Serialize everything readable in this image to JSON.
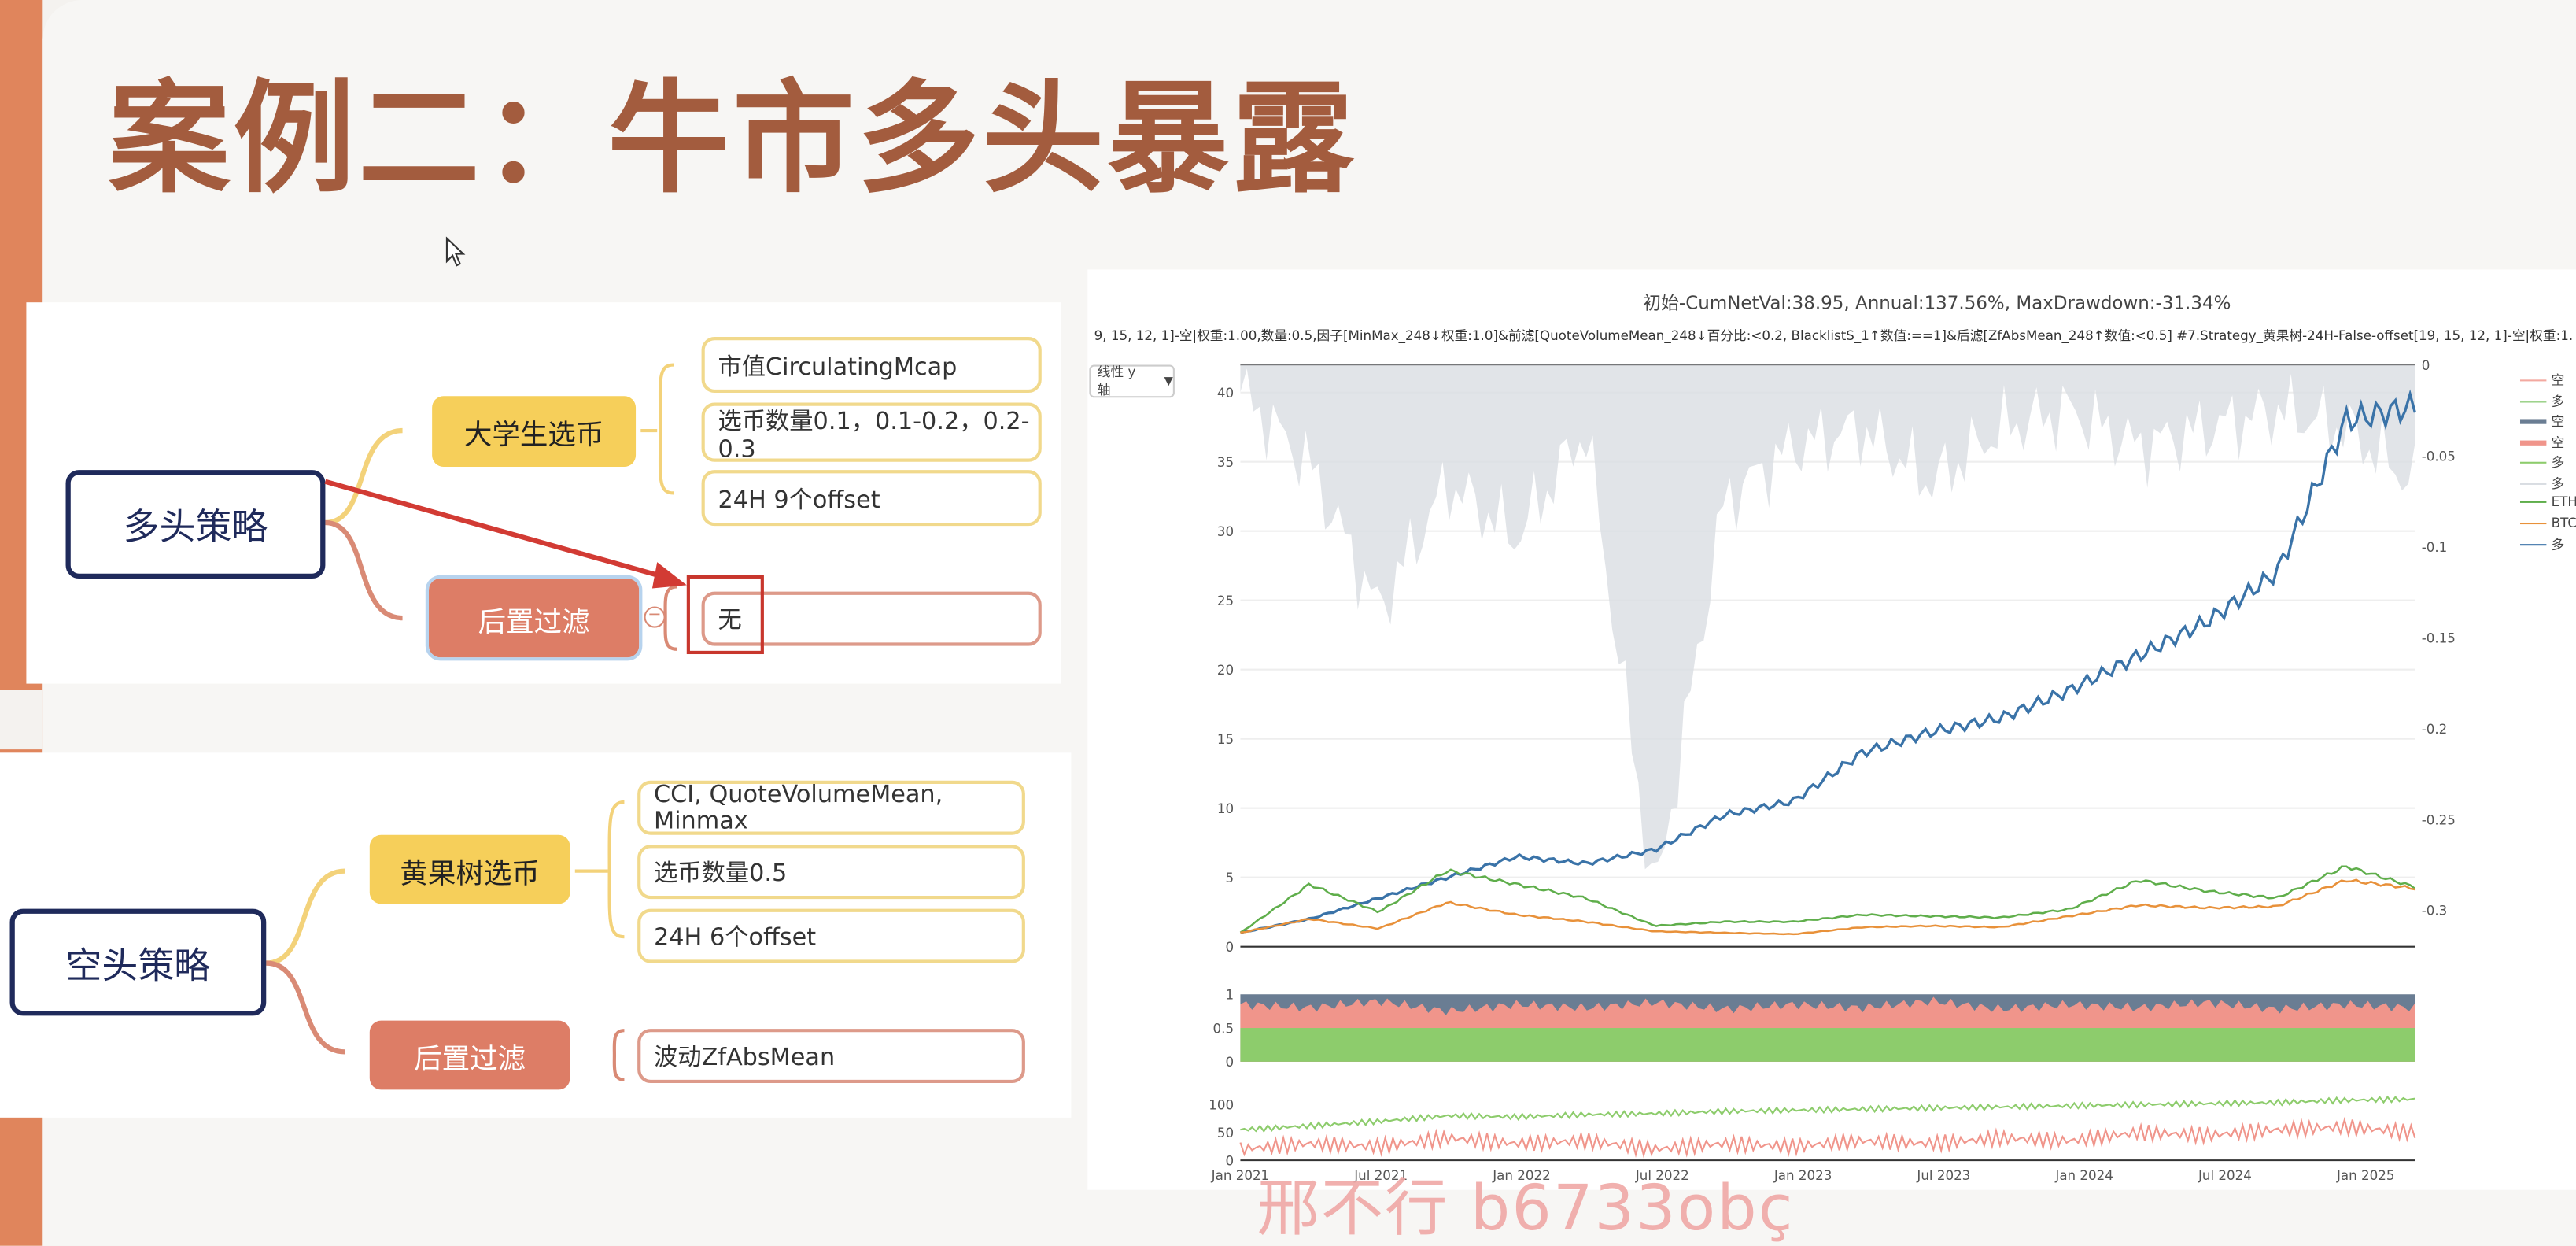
{
  "slide": {
    "title": "案例二：牛市多头暴露"
  },
  "long_strategy": {
    "root": "多头策略",
    "branch1": {
      "label": "大学生选币",
      "leaves": [
        "市值CirculatingMcap",
        "选币数量0.1，0.1-0.2，0.2-0.3",
        "24H 9个offset"
      ]
    },
    "branch2": {
      "label": "后置过滤",
      "leaves": [
        "无"
      ]
    },
    "collapse_symbol": "−"
  },
  "short_strategy": {
    "root": "空头策略",
    "branch1": {
      "label": "黄果树选币",
      "leaves": [
        "CCI, QuoteVolumeMean, Minmax",
        "选币数量0.5",
        "24H 6个offset"
      ]
    },
    "branch2": {
      "label": "后置过滤",
      "leaves": [
        "波动ZfAbsMean"
      ]
    }
  },
  "chart_header": {
    "title": "初始-CumNetVal:38.95, Annual:137.56%, MaxDrawdown:-31.34%",
    "subtitle": "9, 15, 12, 1]-空|权重:1.00,数量:0.5,因子[MinMax_248↓权重:1.0]&前滤[QuoteVolumeMean_248↓百分比:<0.2, BlacklistS_1↑数值:==1]&后滤[ZfAbsMean_248↑数值:<0.5] #7.Strategy_黄果树-24H-False-offset[19, 15, 12, 1]-空|权重:1.00,数量:0.5,因子[MinMax",
    "y_axis_selector": "线性 y轴",
    "dropdown_arrow": "▼"
  },
  "legend": [
    {
      "label": "空",
      "color": "#f3a9a0"
    },
    {
      "label": "多",
      "color": "#9ed38c"
    },
    {
      "label": "空",
      "color": "#6a7d93"
    },
    {
      "label": "空",
      "color": "#f0958b"
    },
    {
      "label": "多",
      "color": "#8dcc6c"
    },
    {
      "label": "多",
      "color": "#d9dde2"
    },
    {
      "label": "ETH",
      "color": "#5fae4b"
    },
    {
      "label": "BTC",
      "color": "#e8913a"
    },
    {
      "label": "多",
      "color": "#3a73a8"
    }
  ],
  "watermark": "邢不行 b6733obç",
  "colors": {
    "accent": "#a35c3e",
    "strategy_line": "#3a73a8",
    "eth_line": "#5fae4b",
    "btc_line": "#e8913a"
  },
  "chart_data": [
    {
      "type": "line",
      "title": "初始-CumNetVal:38.95, Annual:137.56%, MaxDrawdown:-31.34%",
      "x_ticks": [
        "Jan 2021",
        "Jul 2021",
        "Jan 2022",
        "Jul 2022",
        "Jan 2023",
        "Jul 2023",
        "Jan 2024",
        "Jul 2024",
        "Jan 2025"
      ],
      "ylim": [
        0,
        42
      ],
      "y_ticks": [
        0,
        5,
        10,
        15,
        20,
        25,
        30,
        35,
        40
      ],
      "y2_ticks": [
        0,
        -0.05,
        -0.1,
        -0.15,
        -0.2,
        -0.25,
        -0.3
      ],
      "y2lim": [
        -0.32,
        0
      ],
      "x": [
        "2021-01",
        "2021-04",
        "2021-07",
        "2021-10",
        "2022-01",
        "2022-04",
        "2022-07",
        "2022-10",
        "2023-01",
        "2023-04",
        "2023-07",
        "2023-10",
        "2024-01",
        "2024-04",
        "2024-07",
        "2024-10",
        "2025-01",
        "2025-03"
      ],
      "series": [
        {
          "name": "多",
          "values": [
            1,
            2,
            3.5,
            5,
            6.5,
            6,
            7,
            9.5,
            10.5,
            14,
            15.5,
            16.5,
            18.5,
            21,
            23.5,
            27,
            38,
            39
          ]
        },
        {
          "name": "ETH",
          "values": [
            1,
            4.5,
            2.5,
            5.5,
            4.5,
            3.5,
            1.5,
            1.8,
            1.8,
            2.3,
            2.2,
            2.1,
            2.7,
            4.8,
            4.0,
            3.5,
            5.8,
            4.3
          ]
        },
        {
          "name": "BTC",
          "values": [
            1,
            2.0,
            1.3,
            3.2,
            2.3,
            1.8,
            1.1,
            1.0,
            0.9,
            1.4,
            1.5,
            1.4,
            2.2,
            3.0,
            2.8,
            2.9,
            4.8,
            4.2
          ]
        },
        {
          "name": "drawdown",
          "values": [
            0,
            -0.04,
            -0.12,
            -0.05,
            -0.08,
            -0.02,
            -0.28,
            -0.06,
            -0.03,
            -0.02,
            -0.05,
            -0.02,
            -0.01,
            -0.03,
            -0.02,
            -0.01,
            -0.02,
            -0.05
          ]
        }
      ]
    },
    {
      "type": "area",
      "y_ticks": [
        0,
        0.5,
        1
      ],
      "ylim": [
        0,
        1
      ],
      "series": [
        {
          "name": "多",
          "values": [
            0.5,
            0.5,
            0.5,
            0.5,
            0.5,
            0.5,
            0.5,
            0.5,
            0.5,
            0.5,
            0.5,
            0.5,
            0.5,
            0.5,
            0.5,
            0.5,
            0.5,
            0.5
          ]
        },
        {
          "name": "空",
          "values": [
            0.85,
            0.8,
            0.9,
            0.75,
            0.85,
            0.8,
            0.88,
            0.78,
            0.85,
            0.8,
            0.9,
            0.78,
            0.85,
            0.8,
            0.88,
            0.78,
            0.85,
            0.8
          ]
        }
      ]
    },
    {
      "type": "line",
      "y_ticks": [
        0,
        50,
        100
      ],
      "ylim": [
        0,
        130
      ],
      "x_ticks": [
        "Jan 2021",
        "Jul 2021",
        "Jan 2022",
        "Jul 2022",
        "Jan 2023",
        "Jul 2023",
        "Jan 2024",
        "Jul 2024",
        "Jan 2025"
      ],
      "series": [
        {
          "name": "多",
          "values": [
            55,
            62,
            70,
            80,
            78,
            82,
            84,
            88,
            90,
            92,
            94,
            96,
            98,
            100,
            102,
            104,
            108,
            110
          ]
        },
        {
          "name": "空",
          "values": [
            20,
            30,
            25,
            40,
            30,
            35,
            20,
            30,
            25,
            35,
            30,
            40,
            35,
            50,
            45,
            55,
            60,
            50
          ]
        }
      ]
    }
  ]
}
